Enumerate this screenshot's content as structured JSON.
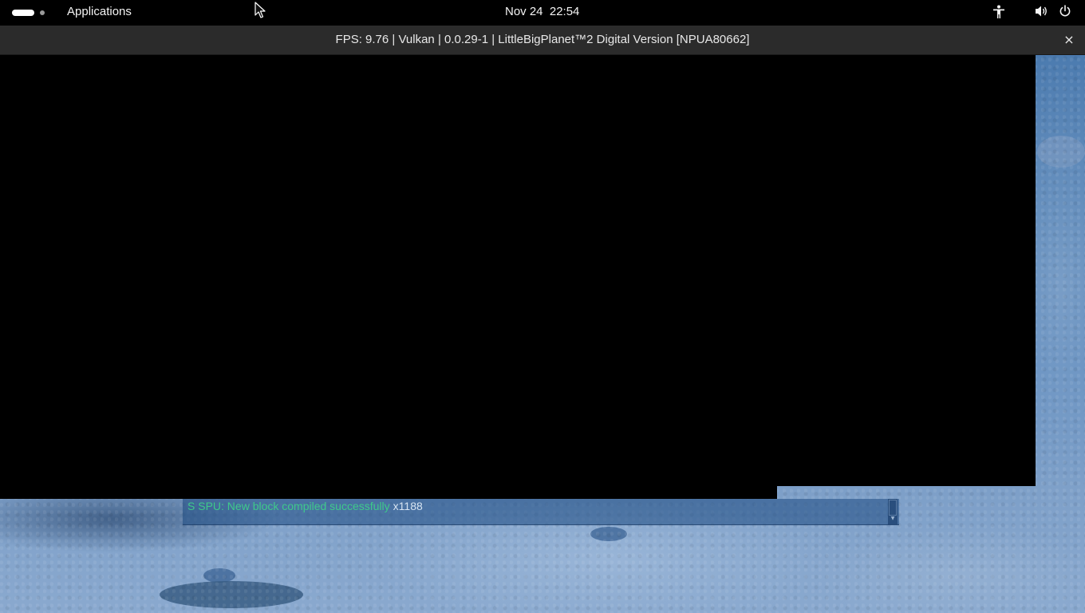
{
  "topbar": {
    "applications_label": "Applications",
    "clock": "Nov 24  22:54",
    "icons": {
      "activities": "activities-indicator-icon",
      "accessibility": "accessibility-icon",
      "volume": "volume-icon",
      "power": "power-icon"
    }
  },
  "window": {
    "title": "FPS: 9.76 | Vulkan | 0.0.29-1 | LittleBigPlanet™2 Digital Version [NPUA80662]",
    "close_label": "×"
  },
  "log": {
    "message": "S SPU: New block compiled successfully",
    "count": "x1188",
    "message_color": "#3ec98a"
  },
  "colors": {
    "topbar_bg": "#000000",
    "titlebar_bg": "#2b2b2b",
    "wallpaper_tint": "#4f7fb4"
  }
}
